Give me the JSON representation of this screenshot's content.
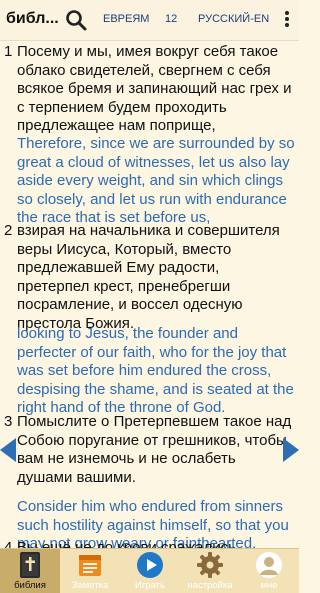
{
  "topbar": {
    "title": "библ...",
    "book": "ЕВРЕЯМ",
    "chapter": "12",
    "translation": "РУССКИЙ-EN"
  },
  "verses": [
    {
      "number": "1",
      "ru": "Посему и мы, имея вокруг себя такое облако свидетелей, свергнем с себя всякое бремя и запинающий нас грех и с терпением будем проходить предлежащее нам поприще,",
      "en": "Therefore, since we are surrounded by so great a cloud of witnesses, let us also lay aside every weight, and sin which clings so closely, and let us run with endurance the race that is set before us,"
    },
    {
      "number": "2",
      "ru": "взирая на начальника и совершителя веры Иисуса, Который, вместо предлежавшей Ему радости, претерпел крест, пренебрегши посрамление, и воссел одесную престола Божия.",
      "en": "looking to Jesus, the founder and perfecter of our faith, who for the joy that was set before him endured the cross, despising the shame, and is seated at the right hand of the throne of God."
    },
    {
      "number": "3",
      "ru": "Помыслите о Претерпевшем такое над Собою поругание от грешников, чтобы вам не изнемочь и не ослабеть душами вашими.",
      "en": "Consider him who endured from sinners such hostility against himself, so that you may not grow weary or fainthearted."
    },
    {
      "number": "4",
      "ru": "Вы ещё не до крови сражались,",
      "en": ""
    }
  ],
  "bottomnav": {
    "tabs": [
      {
        "label": "библия",
        "icon": "bible-icon"
      },
      {
        "label": "Заметка",
        "icon": "note-icon"
      },
      {
        "label": "Играть",
        "icon": "play-icon"
      },
      {
        "label": "настройка",
        "icon": "gear-icon"
      },
      {
        "label": "мне",
        "icon": "person-icon"
      }
    ],
    "active_index": 0
  },
  "colors": {
    "background": "#fdf6e3",
    "english_text": "#2d6bb3",
    "nav_background": "#f2e2b6",
    "arrow": "#2e6eb5"
  }
}
